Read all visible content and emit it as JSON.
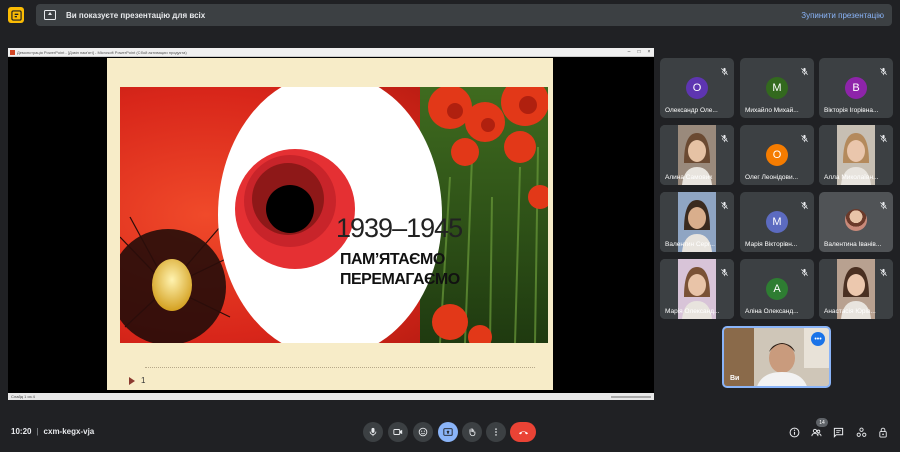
{
  "banner": {
    "text": "Ви показуєте презентацію для всіх",
    "stop_label": "Зупинити презентацію"
  },
  "ppt": {
    "title": "Демонстрація PowerPoint - [Дзвін пам'яті] - Microsoft PowerPoint (Сбой активации продукта)",
    "status": "Слайд 1 из 4"
  },
  "slide": {
    "years": "1939–1945",
    "line1": "ПАМ’ЯТАЄМО",
    "line2": "ПЕРЕМАГАЄМО",
    "number": "1"
  },
  "participants": [
    {
      "name": "Олександр Оле...",
      "initial": "О",
      "color": "#5e35b1",
      "kind": "avatar"
    },
    {
      "name": "Михайло Михай...",
      "initial": "М",
      "color": "#33691e",
      "kind": "avatar"
    },
    {
      "name": "Вікторія Ігорівна...",
      "initial": "В",
      "color": "#8e24aa",
      "kind": "avatar"
    },
    {
      "name": "Алина Самовик",
      "initial": "",
      "color": "",
      "kind": "video"
    },
    {
      "name": "Олег Леонідови...",
      "initial": "О",
      "color": "#f57c00",
      "kind": "avatar"
    },
    {
      "name": "Алла Миколаївн...",
      "initial": "",
      "color": "",
      "kind": "video"
    },
    {
      "name": "Валентин Серг...",
      "initial": "",
      "color": "",
      "kind": "video"
    },
    {
      "name": "Марія Вікторівн...",
      "initial": "М",
      "color": "#5c6bc0",
      "kind": "avatar"
    },
    {
      "name": "Валентина Іванів...",
      "initial": "",
      "color": "",
      "kind": "photo"
    },
    {
      "name": "Марія Олександ...",
      "initial": "",
      "color": "",
      "kind": "video"
    },
    {
      "name": "Аліна Олександ...",
      "initial": "А",
      "color": "#2e7d32",
      "kind": "avatar"
    },
    {
      "name": "Анастасія Юрів...",
      "initial": "",
      "color": "",
      "kind": "video"
    }
  ],
  "self": {
    "name": "Ви"
  },
  "meeting": {
    "time": "10:20",
    "separator": "|",
    "code": "cxm-kegx-vja",
    "participant_count": "14"
  },
  "colors": {
    "accent": "#8ab4f8",
    "hangup": "#ea4335",
    "tile": "#3c4043",
    "background": "#202124"
  }
}
